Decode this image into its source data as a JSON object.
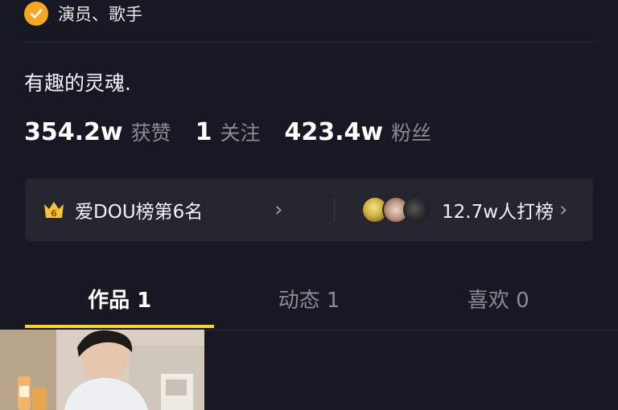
{
  "profile": {
    "verify_text": "演员、歌手",
    "bio": "有趣的灵魂."
  },
  "stats": [
    {
      "value": "354.2w",
      "label": "获赞"
    },
    {
      "value": "1",
      "label": "关注"
    },
    {
      "value": "423.4w",
      "label": "粉丝"
    }
  ],
  "rank": {
    "badge_number": "6",
    "rank_text": "爱DOU榜第6名",
    "support_text": "12.7w人打榜"
  },
  "tabs": [
    {
      "label": "作品 1",
      "active": true
    },
    {
      "label": "动态 1",
      "active": false
    },
    {
      "label": "喜欢 0",
      "active": false
    }
  ],
  "colors": {
    "background": "#161823",
    "accent": "#fcd31e",
    "verify": "#f5a623"
  }
}
